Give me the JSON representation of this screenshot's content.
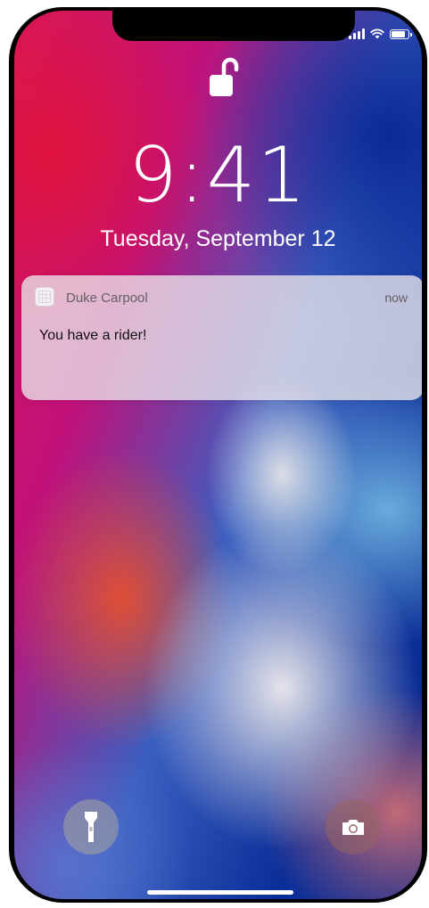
{
  "status_bar": {
    "signal_icon": "cellular-signal-icon",
    "wifi_icon": "wifi-icon",
    "battery_icon": "battery-icon",
    "battery_level": 0.9
  },
  "lock_icon": "unlocked-padlock-icon",
  "lock_screen": {
    "time": "9:41",
    "date": "Tuesday, September 12"
  },
  "notification": {
    "app_icon": "app-icon",
    "app_name": "Duke Carpool",
    "time": "now",
    "message": "You have a rider!"
  },
  "quick_actions": {
    "flashlight_icon": "flashlight-icon",
    "camera_icon": "camera-icon"
  },
  "colors": {
    "notification_bg": "#ebe6eb",
    "text_primary": "#111111",
    "text_secondary": "#666066"
  }
}
